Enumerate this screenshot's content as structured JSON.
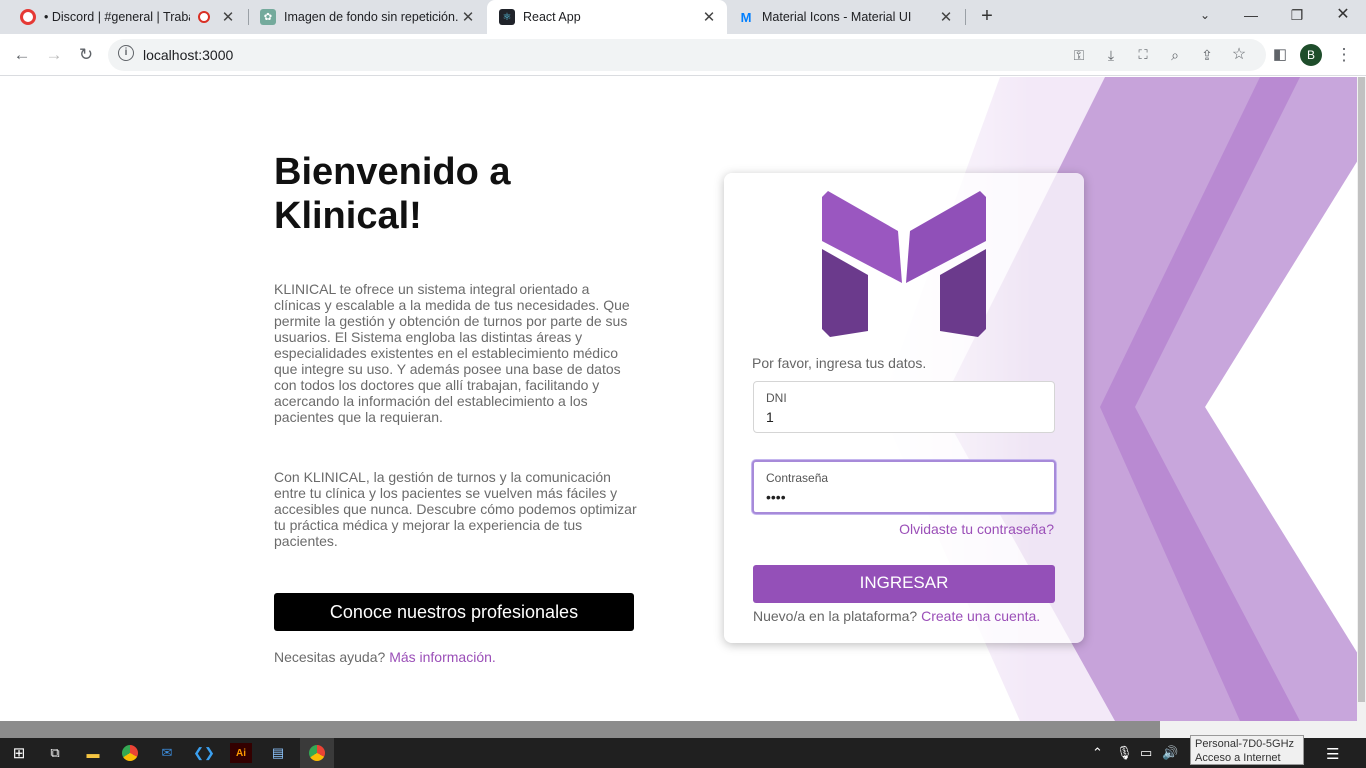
{
  "browser": {
    "tabs": [
      {
        "title": "• Discord | #general | Trabajo",
        "favicon": "discord-icon",
        "close": "✕"
      },
      {
        "title": "Imagen de fondo sin repetición.",
        "favicon": "chatgpt-icon",
        "close": "✕"
      },
      {
        "title": "React App",
        "favicon": "react-icon",
        "close": "✕"
      },
      {
        "title": "Material Icons - Material UI",
        "favicon": "mui-icon",
        "close": "✕"
      }
    ],
    "new_tab": "+",
    "url": "localhost:3000",
    "profile_initial": "B"
  },
  "hero": {
    "title": "Bienvenido a Klinical!",
    "paragraph1": "KLINICAL te ofrece un sistema integral orientado a clínicas y escalable a la medida de tus necesidades. Que permite la gestión y obtención de turnos por parte de sus usuarios. El Sistema engloba las distintas áreas y especialidades existentes en el establecimiento médico que integre su uso. Y además posee una base de datos con todos los doctores que allí trabajan, facilitando y acercando la información del establecimiento a los pacientes que la requieran.",
    "paragraph2": "Con KLINICAL, la gestión de turnos y la comunicación entre tu clínica y los pacientes se vuelven más fáciles y accesibles que nunca. Descubre cómo podemos optimizar tu práctica médica y mejorar la experiencia de tus pacientes.",
    "cta_label": "Conoce nuestros profesionales",
    "help_text": "Necesitas ayuda?",
    "help_link": "Más información."
  },
  "login": {
    "prompt": "Por favor, ingresa tus datos.",
    "dni_label": "DNI",
    "dni_value": "1",
    "password_label": "Contraseña",
    "password_value": "••••",
    "forgot_link": "Olvidaste tu contraseña?",
    "submit_label": "INGRESAR",
    "signup_text": "Nuevo/a en la plataforma?",
    "signup_link": "Create una cuenta."
  },
  "taskbar": {
    "tooltip_line1": "Personal-7D0-5GHz",
    "tooltip_line2": "Acceso a Internet"
  },
  "colors": {
    "accent": "#9450b8",
    "link": "#9b4fb8",
    "logo_light": "#9a57c0",
    "logo_dark": "#6b3a8c"
  }
}
